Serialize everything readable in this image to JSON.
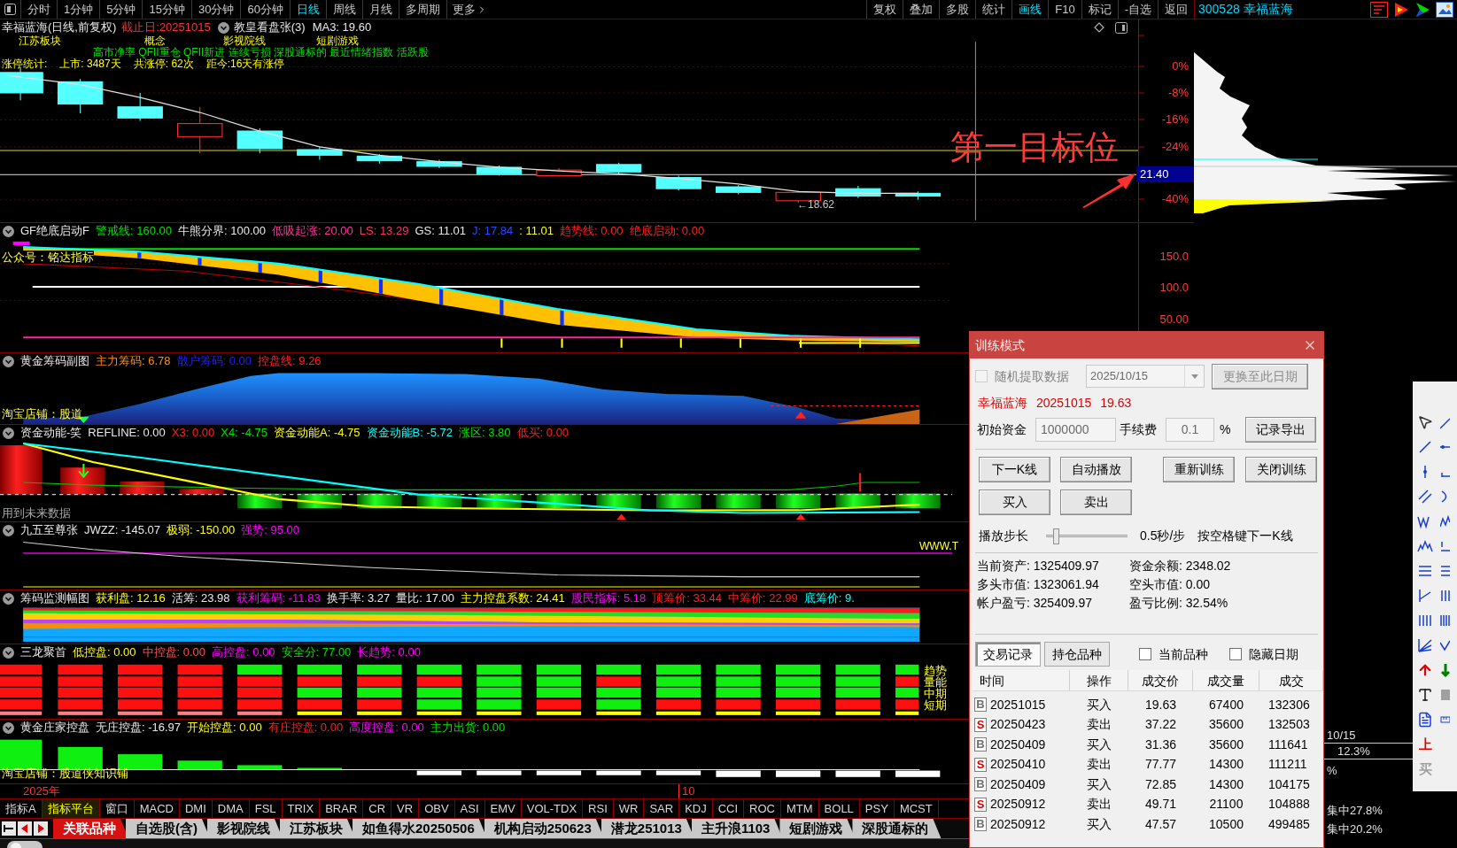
{
  "toolbar": {
    "periods": [
      {
        "label": "分时",
        "selected": false
      },
      {
        "label": "1分钟",
        "selected": false
      },
      {
        "label": "5分钟",
        "selected": false
      },
      {
        "label": "15分钟",
        "selected": false
      },
      {
        "label": "30分钟",
        "selected": false
      },
      {
        "label": "60分钟",
        "selected": false
      },
      {
        "label": "日线",
        "selected": true
      },
      {
        "label": "周线",
        "selected": false
      },
      {
        "label": "月线",
        "selected": false
      },
      {
        "label": "多周期",
        "selected": false
      }
    ],
    "more": "更多",
    "actions": [
      {
        "label": "复权",
        "selected": false
      },
      {
        "label": "叠加",
        "selected": false
      },
      {
        "label": "多股",
        "selected": false
      },
      {
        "label": "统计",
        "selected": false
      },
      {
        "label": "画线",
        "selected": true
      },
      {
        "label": "F10",
        "selected": false
      },
      {
        "label": "标记",
        "selected": false
      },
      {
        "label": "-自选",
        "selected": false
      },
      {
        "label": "返回",
        "selected": false
      }
    ]
  },
  "quote": {
    "code": "300528",
    "name": "幸福蓝海"
  },
  "main_chart": {
    "title": "幸福蓝海(日线,前复权)",
    "end_date": "截止日:20251015",
    "indicator": "教皇看盘张(3)",
    "ma": "MA3: 19.60",
    "tags": [
      "江苏板块",
      "概念",
      "影视院线",
      "短剧游戏"
    ],
    "concepts": "高市净率 QFII重仓 QFII新进 连续亏损 深股通标的 最近情绪指数 活跃股",
    "limit_stats": [
      "涨停统计:",
      "上市: 3487天",
      "共涨停: 62次",
      "距今:16天有涨停"
    ],
    "low_label": "←18.62",
    "target_label": "第一目标位",
    "price_label": "21.40",
    "axis": [
      "0%",
      "-8%",
      "-16%",
      "-24%",
      "-40%"
    ]
  },
  "indicators": [
    {
      "kind": "gf",
      "name": "GF绝底启动F",
      "values": [
        {
          "text": "警戒线: 160.00",
          "color": "#00e000"
        },
        {
          "text": "牛熊分界: 100.00",
          "color": "#e8e8e8"
        },
        {
          "text": "低吸起涨: 20.00",
          "color": "#ff3399"
        },
        {
          "text": "LS: 13.29",
          "color": "#ff3366"
        },
        {
          "text": "GS: 11.01",
          "color": "#e8e8e8"
        },
        {
          "text": "J: 17.84",
          "color": "#2848ff"
        },
        {
          "text": ": 11.01",
          "color": "#ffff00"
        },
        {
          "text": "趋势线: 0.00",
          "color": "#ff2020"
        },
        {
          "text": "绝底启动: 0.00",
          "color": "#ff2020"
        }
      ],
      "notes": [
        "公众号：铭达指标"
      ],
      "axis": [
        "150.0",
        "100.0",
        "50.00"
      ]
    },
    {
      "kind": "gold_chip",
      "name": "黄金筹码副图",
      "values": [
        {
          "text": "主力筹码: 6.78",
          "color": "#ff8c1a"
        },
        {
          "text": "散户筹码: 0.00",
          "color": "#2020ff"
        },
        {
          "text": "控盘线: 9.26",
          "color": "#ff2020"
        }
      ],
      "notes": [
        "淘宝店铺：股道"
      ]
    },
    {
      "kind": "fund_energy",
      "name": "资金动能-笑",
      "values": [
        {
          "text": "REFLINE: 0.00",
          "color": "#e8e8e8"
        },
        {
          "text": "X3: 0.00",
          "color": "#ff2020"
        },
        {
          "text": "X4: -4.75",
          "color": "#00e000"
        },
        {
          "text": "资金动能A: -4.75",
          "color": "#ffff00"
        },
        {
          "text": "资金动能B: -5.72",
          "color": "#00ffff"
        },
        {
          "text": "涨区: 3.80",
          "color": "#00e000"
        },
        {
          "text": "低买: 0.00",
          "color": "#ff2020"
        }
      ],
      "notes": [
        "用到未来数据"
      ]
    },
    {
      "kind": "supreme",
      "name": "九五至尊张",
      "values": [
        {
          "text": "JWZZ: -145.07",
          "color": "#e8e8e8"
        },
        {
          "text": "极弱: -150.00",
          "color": "#ffff00"
        },
        {
          "text": "强势: 95.00",
          "color": "#ff00ff"
        }
      ],
      "notes": [
        "WWW.T"
      ]
    },
    {
      "kind": "chip_monitor",
      "name": "筹码监测幅图",
      "values": [
        {
          "text": "获利盘: 12.16",
          "color": "#ffff00"
        },
        {
          "text": "活筹: 23.98",
          "color": "#e8e8e8"
        },
        {
          "text": "获利筹码: -11.83",
          "color": "#ff00ff"
        },
        {
          "text": "换手率: 3.27",
          "color": "#e8e8e8"
        },
        {
          "text": "量比: 17.00",
          "color": "#e8e8e8"
        },
        {
          "text": "主力控盘系数: 24.41",
          "color": "#ffff00"
        },
        {
          "text": "股民指标: 5.18",
          "color": "#ff00ff"
        },
        {
          "text": "顶筹价: 33.44",
          "color": "#ff2020"
        },
        {
          "text": "中筹价: 22.99",
          "color": "#ff2020"
        },
        {
          "text": "底筹价: 9.",
          "color": "#00ffff"
        }
      ]
    },
    {
      "kind": "three_dragons",
      "name": "三龙聚首",
      "values": [
        {
          "text": "低控盘: 0.00",
          "color": "#ffff00"
        },
        {
          "text": "中控盘: 0.00",
          "color": "#ff5050"
        },
        {
          "text": "高控盘: 0.00",
          "color": "#ff00ff"
        },
        {
          "text": "安全分: 77.00",
          "color": "#00e000"
        },
        {
          "text": "长趋势: 0.00",
          "color": "#ff00ff"
        }
      ],
      "notes": [
        "趋势",
        "量能",
        "中期",
        "短期"
      ]
    },
    {
      "kind": "banker",
      "name": "黄金庄家控盘",
      "values": [
        {
          "text": "无庄控盘: -16.97",
          "color": "#e8e8e8"
        },
        {
          "text": "开始控盘: 0.00",
          "color": "#ffff00"
        },
        {
          "text": "有庄控盘: 0.00",
          "color": "#ff2020"
        },
        {
          "text": "高度控盘: 0.00",
          "color": "#ff00ff"
        },
        {
          "text": "主力出货: 0.00",
          "color": "#00e000"
        }
      ],
      "notes": [
        "淘宝店铺：股道侠知识铺"
      ]
    }
  ],
  "date_axis": {
    "year": "2025年",
    "month": "10"
  },
  "indicator_tabs": [
    {
      "label": "指标A",
      "selected": false
    },
    {
      "label": "指标平台",
      "selected": true
    },
    {
      "label": "窗口",
      "selected": false
    },
    {
      "label": "MACD",
      "selected": false
    },
    {
      "label": "DMI",
      "selected": false
    },
    {
      "label": "DMA",
      "selected": false
    },
    {
      "label": "FSL",
      "selected": false
    },
    {
      "label": "TRIX",
      "selected": false
    },
    {
      "label": "BRAR",
      "selected": false
    },
    {
      "label": "CR",
      "selected": false
    },
    {
      "label": "VR",
      "selected": false
    },
    {
      "label": "OBV",
      "selected": false
    },
    {
      "label": "ASI",
      "selected": false
    },
    {
      "label": "EMV",
      "selected": false
    },
    {
      "label": "VOL-TDX",
      "selected": false
    },
    {
      "label": "RSI",
      "selected": false
    },
    {
      "label": "WR",
      "selected": false
    },
    {
      "label": "SAR",
      "selected": false
    },
    {
      "label": "KDJ",
      "selected": false
    },
    {
      "label": "CCI",
      "selected": false
    },
    {
      "label": "ROC",
      "selected": false
    },
    {
      "label": "MTM",
      "selected": false
    },
    {
      "label": "BOLL",
      "selected": false
    },
    {
      "label": "PSY",
      "selected": false
    },
    {
      "label": "MCST",
      "selected": false
    }
  ],
  "block_tabs": [
    {
      "label": "关联品种",
      "selected": true
    },
    {
      "label": "自选股(含)",
      "selected": false
    },
    {
      "label": "影视院线",
      "selected": false
    },
    {
      "label": "江苏板块",
      "selected": false
    },
    {
      "label": "如鱼得水20250506",
      "selected": false
    },
    {
      "label": "机构启动250623",
      "selected": false
    },
    {
      "label": "潜龙251013",
      "selected": false
    },
    {
      "label": "主升浪1103",
      "selected": false
    },
    {
      "label": "短剧游戏",
      "selected": false
    },
    {
      "label": "深股通标的",
      "selected": false
    }
  ],
  "chip_stats": {
    "date": "10/15",
    "ratio": "12.3%",
    "unit": "%",
    "concentration": [
      "集中27.8%",
      "集中20.2%"
    ]
  },
  "drawing_tools": {
    "text_tools": [
      {
        "kind": "up",
        "label": "上"
      },
      {
        "kind": "buy",
        "label": "买"
      }
    ]
  },
  "training_dialog": {
    "title": "训练模式",
    "random": {
      "label": "随机提取数据",
      "checked": false,
      "disabled": true
    },
    "date": {
      "value": "2025/10/15",
      "disabled": true
    },
    "change_button": {
      "label": "更换至此日期",
      "disabled": true
    },
    "stock": {
      "name": "幸福蓝海",
      "date": "20251015",
      "price": "19.63"
    },
    "capital": {
      "label": "初始资金",
      "value": "1000000",
      "disabled": true
    },
    "fee": {
      "label": "手续费",
      "value": "0.1",
      "unit": "%",
      "disabled": true
    },
    "export_button": "记录导出",
    "controls": [
      "下一K线",
      "自动播放",
      "重新训练",
      "关闭训练"
    ],
    "trade_buttons": [
      "买入",
      "卖出"
    ],
    "speed": {
      "label": "播放步长",
      "level": 0.12,
      "reading": "0.5秒/步",
      "hint": "按空格键下一K线"
    },
    "stats": [
      "当前资产: 1325409.97",
      "资金余额: 2348.02",
      "多头市值: 1323061.94",
      "空头市值: 0.00",
      "帐户盈亏: 325409.97",
      "盈亏比例: 32.54%"
    ],
    "tabs": [
      {
        "label": "交易记录",
        "selected": true
      },
      {
        "label": "持仓品种",
        "selected": false
      }
    ],
    "filters": [
      {
        "label": "当前品种",
        "checked": false
      },
      {
        "label": "隐藏日期",
        "checked": false
      }
    ],
    "table": {
      "columns": [
        "时间",
        "操作",
        "成交价",
        "成交量",
        "成交"
      ],
      "rows": [
        {
          "kind": "buy",
          "side": "B",
          "date": "20251015",
          "action": "买入",
          "price": "19.63",
          "volume": "67400",
          "amount": "132306"
        },
        {
          "kind": "sell",
          "side": "S",
          "date": "20250423",
          "action": "卖出",
          "price": "37.22",
          "volume": "35600",
          "amount": "132503"
        },
        {
          "kind": "buy",
          "side": "B",
          "date": "20250409",
          "action": "买入",
          "price": "31.36",
          "volume": "35600",
          "amount": "111641"
        },
        {
          "kind": "sell",
          "side": "S",
          "date": "20250410",
          "action": "卖出",
          "price": "77.77",
          "volume": "14300",
          "amount": "111211"
        },
        {
          "kind": "buy",
          "side": "B",
          "date": "20250409",
          "action": "买入",
          "price": "72.85",
          "volume": "14300",
          "amount": "104175"
        },
        {
          "kind": "sell",
          "side": "S",
          "date": "20250912",
          "action": "卖出",
          "price": "49.71",
          "volume": "21100",
          "amount": "104888"
        },
        {
          "kind": "buy",
          "side": "B",
          "date": "20250912",
          "action": "买入",
          "price": "47.57",
          "volume": "10500",
          "amount": "499485"
        }
      ]
    }
  }
}
